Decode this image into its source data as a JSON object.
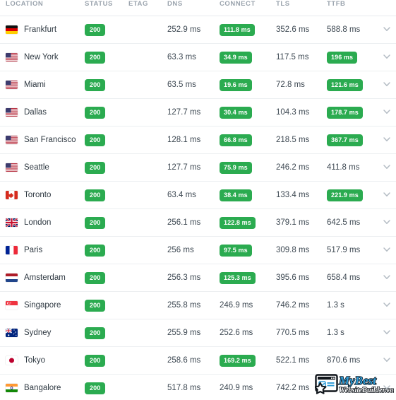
{
  "table": {
    "columns": [
      {
        "key": "location",
        "label": "LOCATION"
      },
      {
        "key": "status",
        "label": "STATUS"
      },
      {
        "key": "etag",
        "label": "ETAG"
      },
      {
        "key": "dns",
        "label": "DNS"
      },
      {
        "key": "connect",
        "label": "CONNECT"
      },
      {
        "key": "tls",
        "label": "TLS"
      },
      {
        "key": "ttfb",
        "label": "TTFB"
      },
      {
        "key": "expand",
        "label": ""
      }
    ],
    "rows": [
      {
        "flag": "flag-de",
        "location": "Frankfurt",
        "status": "200",
        "etag": "",
        "dns": "252.9 ms",
        "connect": "111.8 ms",
        "connect_highlight": true,
        "tls": "352.6 ms",
        "ttfb": "588.8 ms",
        "ttfb_highlight": false,
        "expand_icon": "chevron-down-icon"
      },
      {
        "flag": "flag-us",
        "location": "New York",
        "status": "200",
        "etag": "",
        "dns": "63.3 ms",
        "connect": "34.9 ms",
        "connect_highlight": true,
        "tls": "117.5 ms",
        "ttfb": "196 ms",
        "ttfb_highlight": true,
        "expand_icon": "chevron-down-icon"
      },
      {
        "flag": "flag-us",
        "location": "Miami",
        "status": "200",
        "etag": "",
        "dns": "63.5 ms",
        "connect": "19.6 ms",
        "connect_highlight": true,
        "tls": "72.8 ms",
        "ttfb": "121.6 ms",
        "ttfb_highlight": true,
        "expand_icon": "chevron-down-icon"
      },
      {
        "flag": "flag-us",
        "location": "Dallas",
        "status": "200",
        "etag": "",
        "dns": "127.7 ms",
        "connect": "30.4 ms",
        "connect_highlight": true,
        "tls": "104.3 ms",
        "ttfb": "178.7 ms",
        "ttfb_highlight": true,
        "expand_icon": "chevron-down-icon"
      },
      {
        "flag": "flag-us",
        "location": "San Francisco",
        "status": "200",
        "etag": "",
        "dns": "128.1 ms",
        "connect": "66.8 ms",
        "connect_highlight": true,
        "tls": "218.5 ms",
        "ttfb": "367.7 ms",
        "ttfb_highlight": true,
        "expand_icon": "chevron-down-icon"
      },
      {
        "flag": "flag-us",
        "location": "Seattle",
        "status": "200",
        "etag": "",
        "dns": "127.7 ms",
        "connect": "75.9 ms",
        "connect_highlight": true,
        "tls": "246.2 ms",
        "ttfb": "411.8 ms",
        "ttfb_highlight": false,
        "expand_icon": "chevron-down-icon"
      },
      {
        "flag": "flag-ca",
        "location": "Toronto",
        "status": "200",
        "etag": "",
        "dns": "63.4 ms",
        "connect": "38.4 ms",
        "connect_highlight": true,
        "tls": "133.4 ms",
        "ttfb": "221.9 ms",
        "ttfb_highlight": true,
        "expand_icon": "chevron-down-icon"
      },
      {
        "flag": "flag-gb",
        "location": "London",
        "status": "200",
        "etag": "",
        "dns": "256.1 ms",
        "connect": "122.8 ms",
        "connect_highlight": true,
        "tls": "379.1 ms",
        "ttfb": "642.5 ms",
        "ttfb_highlight": false,
        "expand_icon": "chevron-down-icon"
      },
      {
        "flag": "flag-fr",
        "location": "Paris",
        "status": "200",
        "etag": "",
        "dns": "256 ms",
        "connect": "97.5 ms",
        "connect_highlight": true,
        "tls": "309.8 ms",
        "ttfb": "517.9 ms",
        "ttfb_highlight": false,
        "expand_icon": "chevron-down-icon"
      },
      {
        "flag": "flag-nl",
        "location": "Amsterdam",
        "status": "200",
        "etag": "",
        "dns": "256.3 ms",
        "connect": "125.3 ms",
        "connect_highlight": true,
        "tls": "395.6 ms",
        "ttfb": "658.4 ms",
        "ttfb_highlight": false,
        "expand_icon": "chevron-down-icon"
      },
      {
        "flag": "flag-sg",
        "location": "Singapore",
        "status": "200",
        "etag": "",
        "dns": "255.8 ms",
        "connect": "246.9 ms",
        "connect_highlight": false,
        "tls": "746.2 ms",
        "ttfb": "1.3 s",
        "ttfb_highlight": false,
        "expand_icon": "chevron-down-icon"
      },
      {
        "flag": "flag-au",
        "location": "Sydney",
        "status": "200",
        "etag": "",
        "dns": "255.9 ms",
        "connect": "252.6 ms",
        "connect_highlight": false,
        "tls": "770.5 ms",
        "ttfb": "1.3 s",
        "ttfb_highlight": false,
        "expand_icon": "chevron-down-icon"
      },
      {
        "flag": "flag-jp",
        "location": "Tokyo",
        "status": "200",
        "etag": "",
        "dns": "258.6 ms",
        "connect": "169.2 ms",
        "connect_highlight": true,
        "tls": "522.1 ms",
        "ttfb": "870.6 ms",
        "ttfb_highlight": false,
        "expand_icon": "chevron-down-icon"
      },
      {
        "flag": "flag-in",
        "location": "Bangalore",
        "status": "200",
        "etag": "",
        "dns": "517.8 ms",
        "connect": "240.9 ms",
        "connect_highlight": false,
        "tls": "742.2 ms",
        "ttfb": "",
        "ttfb_highlight": false,
        "expand_icon": "chevron-down-icon"
      }
    ]
  },
  "watermark": {
    "line1": "MyBest",
    "line2": "WebsiteBuilder.com",
    "icon": "browser-window-star-icon"
  },
  "colors": {
    "badge_green": "#2bab50",
    "header_text": "#9aa3ad",
    "body_text": "#3d4852",
    "row_divider": "#eceff1",
    "background": "#ffffff",
    "watermark_blue": "#2e9bd6"
  }
}
